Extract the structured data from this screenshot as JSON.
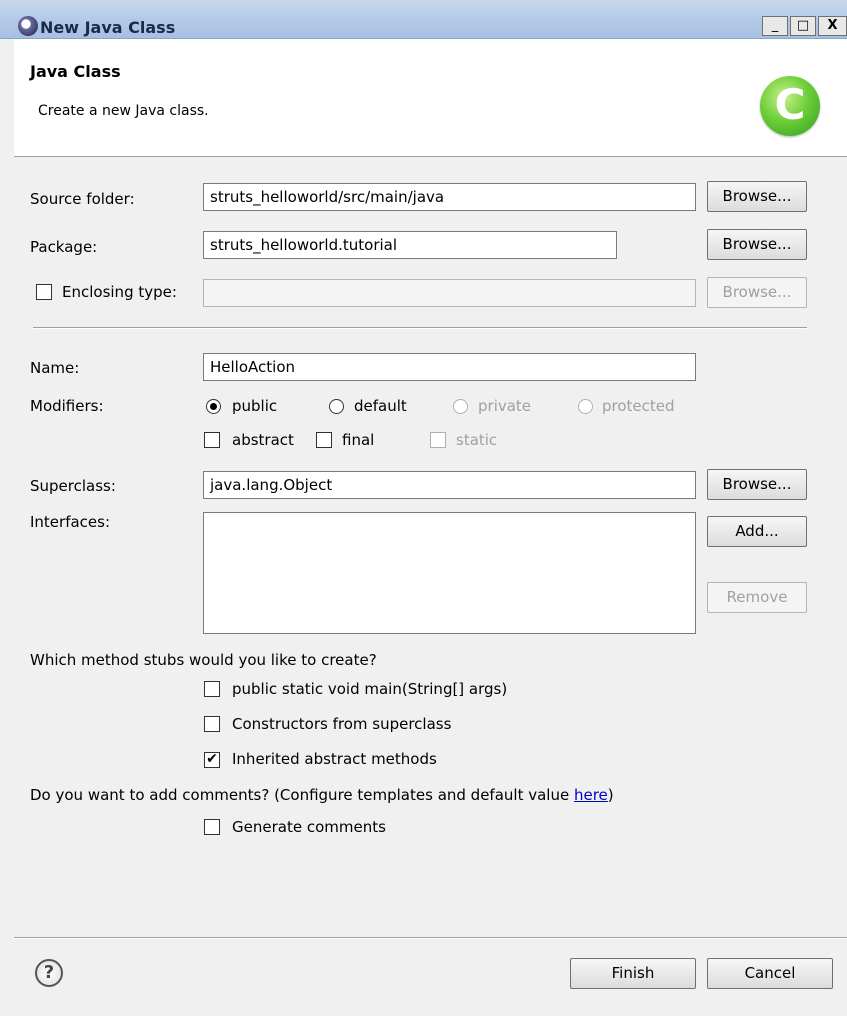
{
  "window": {
    "title": "New Java Class",
    "controls": [
      "_",
      "□",
      "X"
    ]
  },
  "header": {
    "title": "Java Class",
    "description": "Create a new Java class.",
    "badge_letter": "C"
  },
  "source_folder": {
    "label": "Source folder:",
    "value": "struts_helloworld/src/main/java",
    "browse": "Browse..."
  },
  "package": {
    "label": "Package:",
    "value": "struts_helloworld.tutorial",
    "browse": "Browse..."
  },
  "enclosing": {
    "label": "Enclosing type:",
    "value": "",
    "checked": false,
    "browse": "Browse..."
  },
  "name": {
    "label": "Name:",
    "value": "HelloAction"
  },
  "modifiers": {
    "label": "Modifiers:",
    "access": [
      {
        "label": "public",
        "selected": true,
        "enabled": true
      },
      {
        "label": "default",
        "selected": false,
        "enabled": true
      },
      {
        "label": "private",
        "selected": false,
        "enabled": false
      },
      {
        "label": "protected",
        "selected": false,
        "enabled": false
      }
    ],
    "flags": [
      {
        "label": "abstract",
        "checked": false,
        "enabled": true
      },
      {
        "label": "final",
        "checked": false,
        "enabled": true
      },
      {
        "label": "static",
        "checked": false,
        "enabled": false
      }
    ]
  },
  "superclass": {
    "label": "Superclass:",
    "value": "java.lang.Object",
    "browse": "Browse..."
  },
  "interfaces": {
    "label": "Interfaces:",
    "add": "Add...",
    "remove": "Remove"
  },
  "stubs": {
    "question": "Which method stubs would you like to create?",
    "options": [
      {
        "label": "public static void main(String[] args)",
        "checked": false
      },
      {
        "label": "Constructors from superclass",
        "checked": false
      },
      {
        "label": "Inherited abstract methods",
        "checked": true
      }
    ]
  },
  "comments": {
    "question": "Do you want to add comments? (Configure templates and default value ",
    "link": "here",
    "question_end": ")",
    "option": "Generate comments",
    "checked": false
  },
  "footer": {
    "help": "?",
    "finish": "Finish",
    "cancel": "Cancel"
  }
}
